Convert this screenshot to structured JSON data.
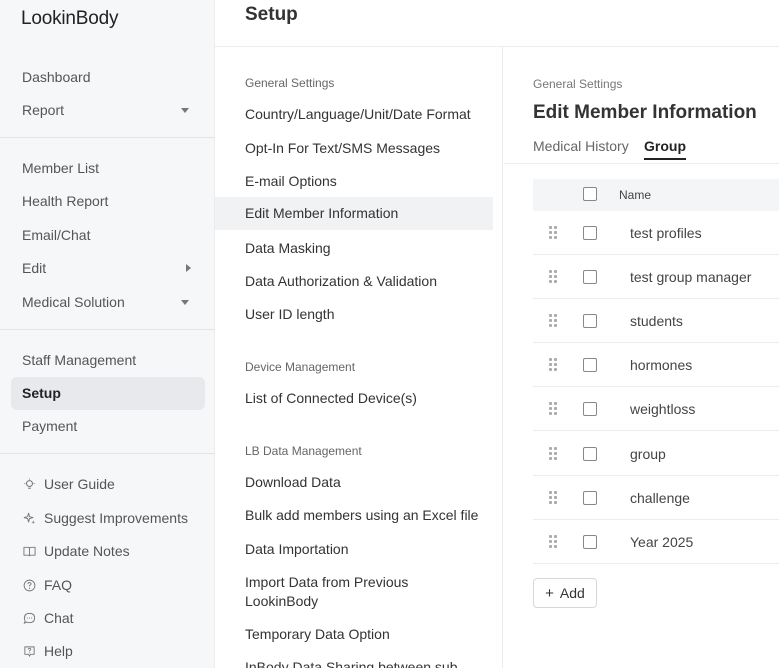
{
  "app": {
    "logo": "LookinBody",
    "page_title": "Setup"
  },
  "sidebar": {
    "group1": [
      "Dashboard",
      "Report"
    ],
    "group2": [
      "Member List",
      "Health Report",
      "Email/Chat",
      "Edit",
      "Medical Solution"
    ],
    "group3": [
      "Staff Management",
      "Setup",
      "Payment"
    ],
    "help": [
      {
        "label": "User Guide",
        "icon": "lightbulb-icon"
      },
      {
        "label": "Suggest Improvements",
        "icon": "sparkle-icon"
      },
      {
        "label": "Update Notes",
        "icon": "book-icon"
      },
      {
        "label": "FAQ",
        "icon": "question-icon"
      },
      {
        "label": "Chat",
        "icon": "chat-icon"
      },
      {
        "label": "Help",
        "icon": "help-icon"
      }
    ],
    "active": "Setup"
  },
  "settings": {
    "general_title": "General Settings",
    "general": [
      "Country/Language/Unit/Date Format",
      "Opt-In For Text/SMS Messages",
      "E-mail Options",
      "Edit Member Information",
      "Data Masking",
      "Data Authorization & Validation",
      "User ID length"
    ],
    "device_title": "Device Management",
    "device": [
      "List of Connected Device(s)"
    ],
    "lb_title": "LB Data Management",
    "lb": [
      "Download Data",
      "Bulk add members using an Excel file",
      "Data Importation",
      "Import Data from Previous LookinBody",
      "Temporary Data Option",
      "InBody Data Sharing between sub"
    ],
    "active": "Edit Member Information"
  },
  "detail": {
    "breadcrumb": "General Settings",
    "title": "Edit Member Information",
    "tabs": [
      "Medical History",
      "Group"
    ],
    "active_tab": "Group",
    "table_header": "Name",
    "rows": [
      "test profiles",
      "test group manager",
      "students",
      "hormones",
      "weightloss",
      "group",
      "challenge",
      "Year 2025"
    ],
    "add_label": "Add"
  }
}
